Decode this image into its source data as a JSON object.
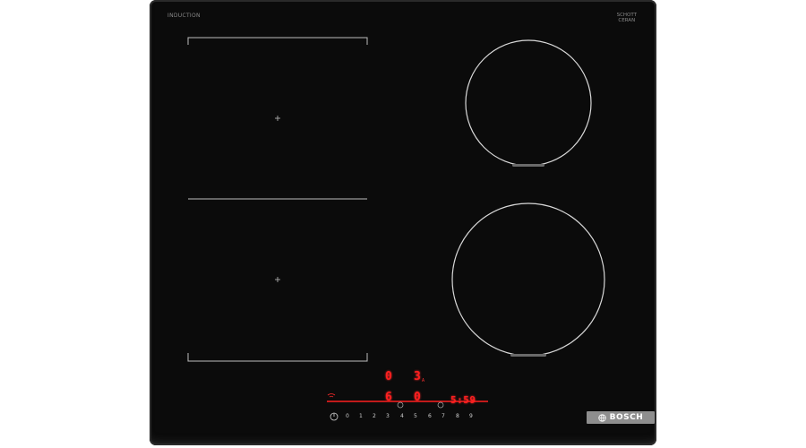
{
  "brand_top_left": "INDUCTION",
  "brand_top_left_sub": "",
  "brand_top_right": [
    "SCHOTT",
    "CERAN"
  ],
  "display": {
    "top_left_digit": "0",
    "top_right_digit": "3",
    "top_right_suffix": "A",
    "mid_left_digit": "6",
    "mid_right_digit": "0",
    "timer": "5:59",
    "small_left_label": "",
    "small_mid_label": ""
  },
  "power_scale": [
    "0",
    "1",
    "2",
    "3",
    "4",
    "5",
    "6",
    "7",
    "8",
    "9"
  ],
  "icons": {
    "power": "power-icon",
    "wifi": "wifi-icon",
    "lock": "lock-icon",
    "timer": "timer-icon",
    "flex": "flex-zone-icon"
  },
  "logo": {
    "text": "BOSCH"
  },
  "colors": {
    "glass": "#0b0b0b",
    "display_red": "#ff1f1f",
    "zone_line": "#cfcfcf",
    "logo_bg": "#8e8e8e"
  }
}
